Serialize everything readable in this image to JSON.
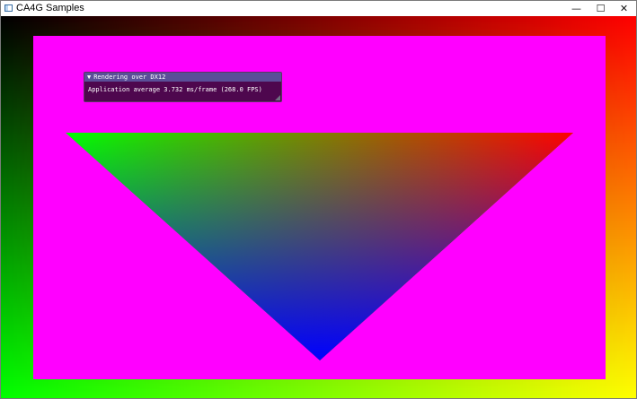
{
  "window": {
    "title": "CA4G Samples",
    "app_icon": "app-window-icon",
    "controls": {
      "minimize_glyph": "—",
      "maximize_glyph": "☐",
      "close_glyph": "✕"
    }
  },
  "imgui_panel": {
    "collapse_glyph": "▼",
    "title": "Rendering over DX12",
    "text": "Application average 3.732 ms/frame (268.0 FPS)"
  },
  "colors": {
    "clear_corners": {
      "top_left": "#000000",
      "top_right": "#ff0000",
      "bottom_left": "#00ff00",
      "bottom_right": "#ffff00"
    },
    "inner_rect": "#ff00ff",
    "triangle_vertices": {
      "left": "#00ff00",
      "right": "#ff0000",
      "bottom": "#0000ff"
    },
    "imgui_header": "#5a4f98"
  }
}
